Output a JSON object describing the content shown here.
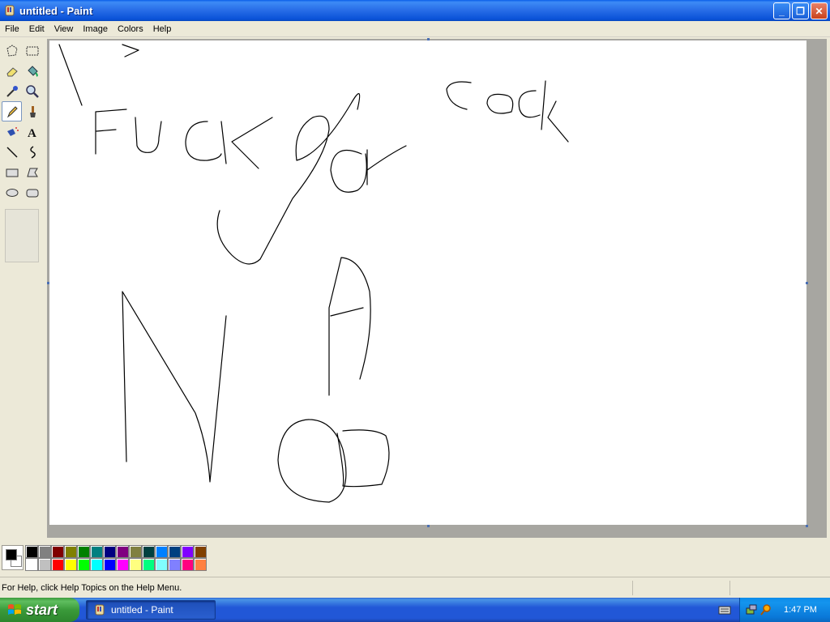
{
  "window": {
    "title": "untitled - Paint"
  },
  "window_buttons": {
    "minimize": "_",
    "restore": "❐",
    "close": "✕"
  },
  "menu": [
    "File",
    "Edit",
    "View",
    "Image",
    "Colors",
    "Help"
  ],
  "tools": [
    "free-form-select",
    "select",
    "eraser",
    "fill-with-color",
    "pick-color",
    "magnifier",
    "pencil",
    "brush",
    "airbrush",
    "text",
    "line",
    "curve",
    "rectangle",
    "polygon",
    "ellipse",
    "rounded-rectangle"
  ],
  "active_tool": "pencil",
  "colors": {
    "foreground": "#000000",
    "background": "#ffffff",
    "palette": [
      "#000000",
      "#808080",
      "#800000",
      "#808000",
      "#008000",
      "#008080",
      "#000080",
      "#800080",
      "#808040",
      "#004040",
      "#0080ff",
      "#004080",
      "#8000ff",
      "#804000",
      "#ffffff",
      "#c0c0c0",
      "#ff0000",
      "#ffff00",
      "#00ff00",
      "#00ffff",
      "#0000ff",
      "#ff00ff",
      "#ffff80",
      "#00ff80",
      "#80ffff",
      "#8080ff",
      "#ff0080",
      "#ff8040"
    ]
  },
  "status": {
    "help_text": "For Help, click Help Topics on the Help Menu."
  },
  "taskbar": {
    "start_label": "start",
    "task_label": "untitled - Paint",
    "clock": "1:47 PM"
  }
}
